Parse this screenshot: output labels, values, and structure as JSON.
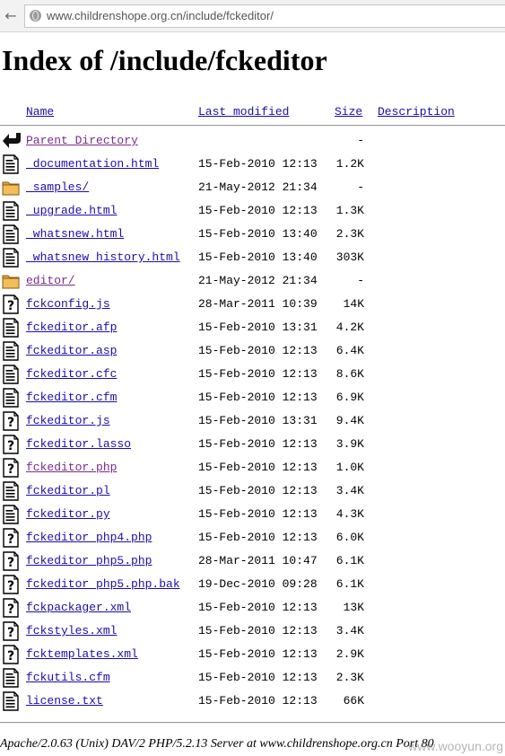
{
  "browser": {
    "back_glyph": "←",
    "url": "www.childrenshope.org.cn/include/fckeditor/"
  },
  "page": {
    "title": "Index of /include/fckeditor"
  },
  "columns": {
    "name": "Name",
    "last_modified": "Last modified",
    "size": "Size",
    "description": "Description"
  },
  "rows": [
    {
      "icon": "back-icon",
      "name": "Parent Directory",
      "date": "",
      "size": "-",
      "visited": true
    },
    {
      "icon": "text-icon",
      "name": "_documentation.html",
      "date": "15-Feb-2010 12:13",
      "size": "1.2K",
      "visited": false
    },
    {
      "icon": "folder-icon",
      "name": "_samples/",
      "date": "21-May-2012 21:34",
      "size": "-",
      "visited": false
    },
    {
      "icon": "text-icon",
      "name": "_upgrade.html",
      "date": "15-Feb-2010 12:13",
      "size": "1.3K",
      "visited": false
    },
    {
      "icon": "text-icon",
      "name": "_whatsnew.html",
      "date": "15-Feb-2010 13:40",
      "size": "2.3K",
      "visited": false
    },
    {
      "icon": "text-icon",
      "name": "_whatsnew_history.html",
      "date": "15-Feb-2010 13:40",
      "size": "303K",
      "visited": false
    },
    {
      "icon": "folder-icon",
      "name": "editor/",
      "date": "21-May-2012 21:34",
      "size": "-",
      "visited": true
    },
    {
      "icon": "unknown-icon",
      "name": "fckconfig.js",
      "date": "28-Mar-2011 10:39",
      "size": "14K",
      "visited": false
    },
    {
      "icon": "text-icon",
      "name": "fckeditor.afp",
      "date": "15-Feb-2010 13:31",
      "size": "4.2K",
      "visited": false
    },
    {
      "icon": "text-icon",
      "name": "fckeditor.asp",
      "date": "15-Feb-2010 12:13",
      "size": "6.4K",
      "visited": false
    },
    {
      "icon": "text-icon",
      "name": "fckeditor.cfc",
      "date": "15-Feb-2010 12:13",
      "size": "8.6K",
      "visited": false
    },
    {
      "icon": "text-icon",
      "name": "fckeditor.cfm",
      "date": "15-Feb-2010 12:13",
      "size": "6.9K",
      "visited": false
    },
    {
      "icon": "unknown-icon",
      "name": "fckeditor.js",
      "date": "15-Feb-2010 13:31",
      "size": "9.4K",
      "visited": false
    },
    {
      "icon": "unknown-icon",
      "name": "fckeditor.lasso",
      "date": "15-Feb-2010 12:13",
      "size": "3.9K",
      "visited": false
    },
    {
      "icon": "unknown-icon",
      "name": "fckeditor.php",
      "date": "15-Feb-2010 12:13",
      "size": "1.0K",
      "visited": true
    },
    {
      "icon": "text-icon",
      "name": "fckeditor.pl",
      "date": "15-Feb-2010 12:13",
      "size": "3.4K",
      "visited": false
    },
    {
      "icon": "text-icon",
      "name": "fckeditor.py",
      "date": "15-Feb-2010 12:13",
      "size": "4.3K",
      "visited": false
    },
    {
      "icon": "unknown-icon",
      "name": "fckeditor_php4.php",
      "date": "15-Feb-2010 12:13",
      "size": "6.0K",
      "visited": false
    },
    {
      "icon": "unknown-icon",
      "name": "fckeditor_php5.php",
      "date": "28-Mar-2011 10:47",
      "size": "6.1K",
      "visited": false
    },
    {
      "icon": "unknown-icon",
      "name": "fckeditor_php5.php.bak",
      "date": "19-Dec-2010 09:28",
      "size": "6.1K",
      "visited": false
    },
    {
      "icon": "unknown-icon",
      "name": "fckpackager.xml",
      "date": "15-Feb-2010 12:13",
      "size": "13K",
      "visited": false
    },
    {
      "icon": "unknown-icon",
      "name": "fckstyles.xml",
      "date": "15-Feb-2010 12:13",
      "size": "3.4K",
      "visited": false
    },
    {
      "icon": "unknown-icon",
      "name": "fcktemplates.xml",
      "date": "15-Feb-2010 12:13",
      "size": "2.9K",
      "visited": false
    },
    {
      "icon": "text-icon",
      "name": "fckutils.cfm",
      "date": "15-Feb-2010 12:13",
      "size": "2.3K",
      "visited": false
    },
    {
      "icon": "text-icon",
      "name": "license.txt",
      "date": "15-Feb-2010 12:13",
      "size": "66K",
      "visited": false
    }
  ],
  "footer": {
    "address": "Apache/2.0.63 (Unix) DAV/2 PHP/5.2.13 Server at www.childrenshope.org.cn Port 80"
  },
  "watermark": "www.wooyun.org",
  "colors": {
    "link": "#1a0dab",
    "visited_link": "#7a2a8c",
    "folder": "#e8a33d"
  }
}
